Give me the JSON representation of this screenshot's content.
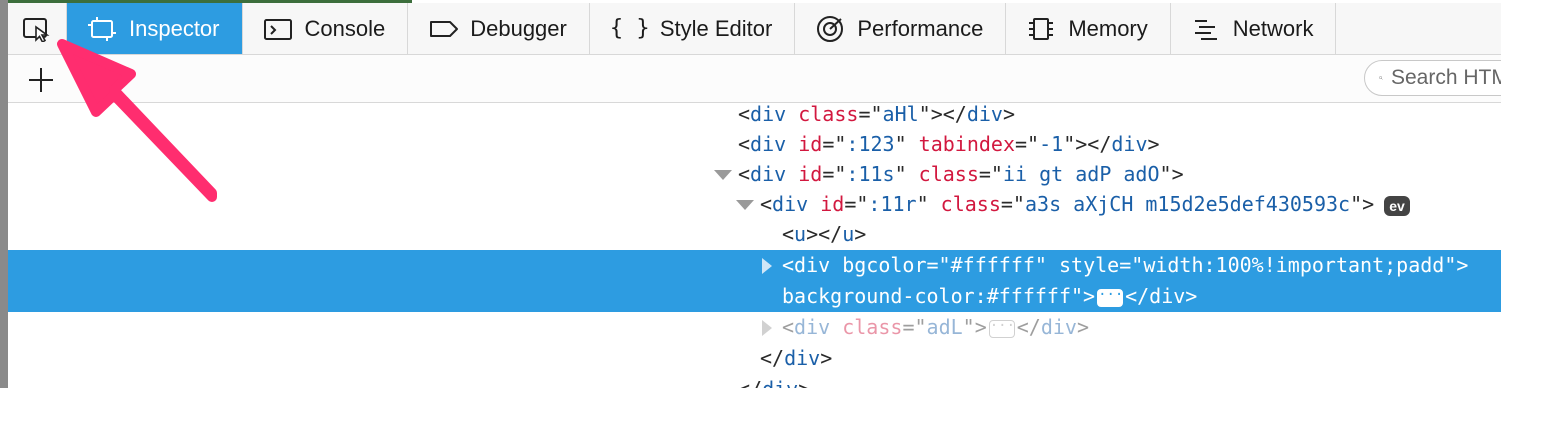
{
  "tabs": [
    {
      "label": "Inspector",
      "icon": "inspector-icon",
      "selected": true
    },
    {
      "label": "Console",
      "icon": "console-icon",
      "selected": false
    },
    {
      "label": "Debugger",
      "icon": "debugger-icon",
      "selected": false
    },
    {
      "label": "Style Editor",
      "icon": "braces-icon",
      "glyph": "{ }",
      "selected": false
    },
    {
      "label": "Performance",
      "icon": "performance-icon",
      "selected": false
    },
    {
      "label": "Memory",
      "icon": "memory-icon",
      "selected": false
    },
    {
      "label": "Network",
      "icon": "network-icon",
      "selected": false
    }
  ],
  "toolbar": {
    "search_placeholder": "Search HTML"
  },
  "markup": [
    {
      "tag": "div",
      "attrs": [
        [
          "class",
          "aHl"
        ]
      ],
      "close": "div"
    },
    {
      "tag": "div",
      "attrs": [
        [
          "id",
          ":123"
        ],
        [
          "tabindex",
          "-1"
        ]
      ],
      "close": "div"
    },
    {
      "tag": "div",
      "attrs": [
        [
          "id",
          ":11s"
        ],
        [
          "class",
          "ii gt adP adO"
        ]
      ],
      "twisty": "down"
    },
    {
      "tag": "div",
      "attrs": [
        [
          "id",
          ":11r"
        ],
        [
          "class",
          "a3s aXjCH m15d2e5def430593c"
        ]
      ],
      "twisty": "down",
      "badge": "ev"
    },
    {
      "tag": "u",
      "attrs": [],
      "close": "u"
    },
    {
      "tag": "div",
      "attrs": [
        [
          "bgcolor",
          "#ffffff"
        ],
        [
          "style",
          "width:100%!important;padd"
        ]
      ],
      "twisty": "right",
      "selected": true
    },
    {
      "continuation": "background-color:#ffffff\"",
      "close": "div",
      "ellipsis": true,
      "selected": true
    },
    {
      "tag": "div",
      "attrs": [
        [
          "class",
          "adL"
        ]
      ],
      "twisty": "right",
      "close": "div",
      "ellipsis": true,
      "dim": true
    },
    {
      "closing": "div"
    },
    {
      "closing": "div"
    }
  ],
  "colors": {
    "accent": "#2d9ce1",
    "annotation_arrow": "#ff2d6f"
  }
}
